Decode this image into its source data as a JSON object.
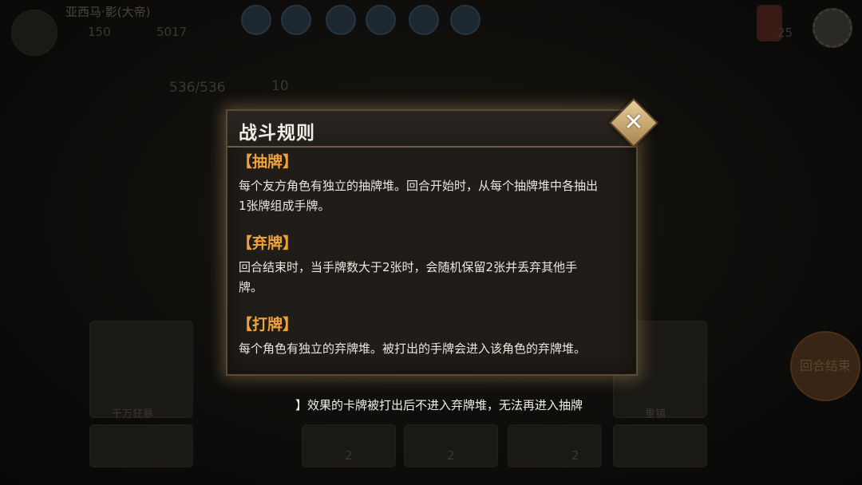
{
  "background": {
    "player_name": "亚西马·影(大帝)",
    "gold": "150",
    "gems": "5017",
    "hp": "536/536",
    "shield": "10",
    "settings_ghost": "设置",
    "end_turn_label": "回合结束",
    "card_name_left": "千万狂暴",
    "card_name_right": "重镇",
    "energy": "25",
    "counts": [
      "2",
      "2",
      "2"
    ]
  },
  "dialog": {
    "title": "战斗规则",
    "close_icon": "✕",
    "sections": [
      {
        "heading": "【抽牌】",
        "lines": [
          "每个友方角色有独立的抽牌堆。回合开始时，从每个抽牌堆中各抽出",
          "1张牌组成手牌。"
        ]
      },
      {
        "heading": "【弃牌】",
        "lines": [
          "回合结束时，当手牌数大于2张时，会随机保留2张并丢弃其他手",
          "牌。"
        ]
      },
      {
        "heading": "【打牌】",
        "lines": [
          "每个角色有独立的弃牌堆。被打出的手牌会进入该角色的弃牌堆。"
        ]
      }
    ]
  },
  "tip": {
    "text": "】效果的卡牌被打出后不进入弃牌堆，无法再进入抽牌"
  },
  "colors": {
    "heading": "#f0a23a",
    "body_text": "#ebe6de",
    "title": "#f2ede4",
    "dialog_bg": "#201c17",
    "close_button": "#d2b27a"
  }
}
